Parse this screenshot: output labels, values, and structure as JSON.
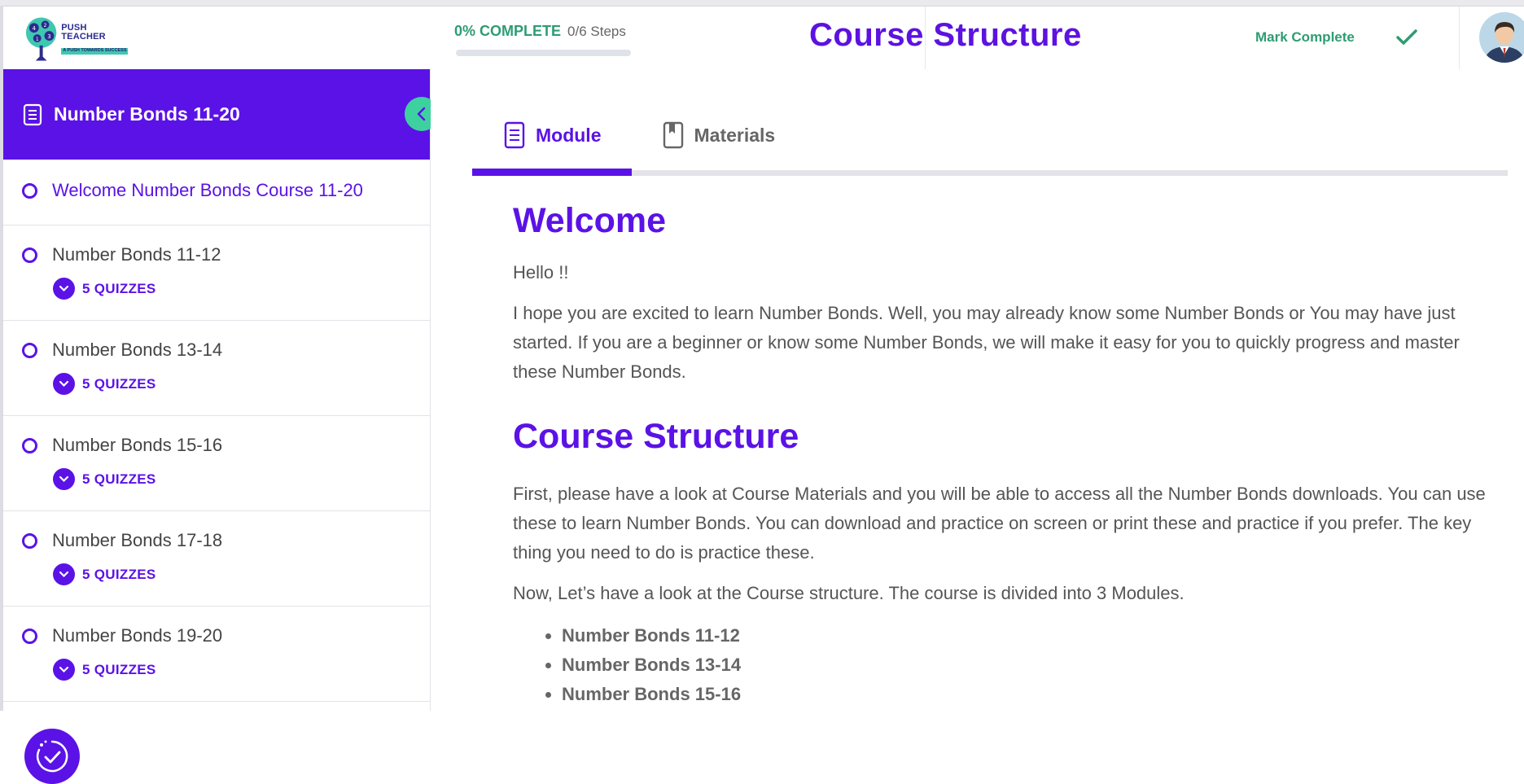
{
  "brand": {
    "logo_title": "PUSH TEACHER",
    "logo_tagline": "A PUSH TOWARDS SUCCESS",
    "accent_color": "#5b12e6",
    "success_color": "#2e9c73"
  },
  "header": {
    "progress_percent_label": "0% COMPLETE",
    "progress_steps": "0/6 Steps",
    "progress_fraction": 0,
    "page_title": "Course Structure",
    "mark_complete_label": "Mark Complete",
    "mark_complete_icon": "check-icon",
    "avatar_icon": "user-avatar"
  },
  "sidebar": {
    "course_title": "Number Bonds 11-20",
    "collapse_icon": "chevron-left-icon",
    "items": [
      {
        "label": "Welcome Number Bonds Course 11-20",
        "active": true,
        "quiz_label": ""
      },
      {
        "label": "Number Bonds 11-12",
        "active": false,
        "quiz_label": "5 QUIZZES"
      },
      {
        "label": "Number Bonds 13-14",
        "active": false,
        "quiz_label": "5 QUIZZES"
      },
      {
        "label": "Number Bonds 15-16",
        "active": false,
        "quiz_label": "5 QUIZZES"
      },
      {
        "label": "Number Bonds 17-18",
        "active": false,
        "quiz_label": "5 QUIZZES"
      },
      {
        "label": "Number Bonds 19-20",
        "active": false,
        "quiz_label": "5 QUIZZES"
      }
    ]
  },
  "main": {
    "tabs": [
      {
        "label": "Module",
        "icon": "document-icon",
        "active": true
      },
      {
        "label": "Materials",
        "icon": "bookmark-book-icon",
        "active": false
      }
    ],
    "welcome_heading": "Welcome",
    "greeting": "Hello !!",
    "intro_paragraph": "I hope you are excited to learn Number Bonds. Well, you may already know some Number Bonds or You may have just started. If you are a beginner or know some Number Bonds, we will make it easy for you to quickly progress and master these Number Bonds.",
    "structure_heading": "Course Structure",
    "structure_paragraph": "First, please have a look at Course Materials and you will be able to access all the Number Bonds downloads. You can use these to learn Number Bonds. You can download and practice on screen or print these and practice if you prefer. The key thing you need to do is practice these.",
    "modules_intro": "Now, Let’s have a look at the Course structure. The course is divided into 3 Modules.",
    "module_list": [
      "Number Bonds 11-12",
      "Number Bonds 13-14",
      "Number Bonds 15-16"
    ]
  }
}
